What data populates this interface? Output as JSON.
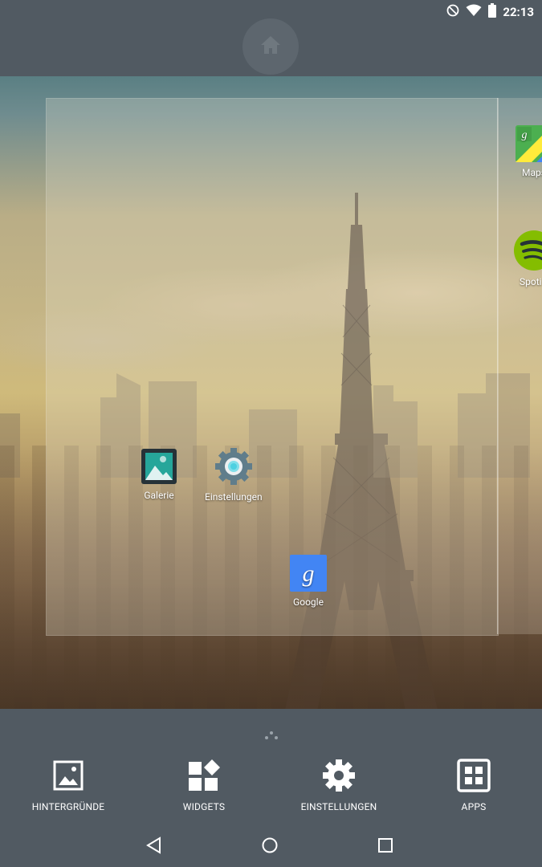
{
  "status_bar": {
    "time": "22:13",
    "icons": [
      "do-not-disturb-icon",
      "wifi-icon",
      "battery-icon"
    ]
  },
  "home_indicator": {
    "icon": "home-icon"
  },
  "workspace": {
    "apps": [
      {
        "label": "Galerie",
        "icon": "gallery-icon"
      },
      {
        "label": "Einstellungen",
        "icon": "settings-gear-icon"
      },
      {
        "label": "Google",
        "icon": "google-g-icon"
      }
    ],
    "next_page_apps": [
      {
        "label": "Maps",
        "icon": "maps-icon"
      },
      {
        "label": "Spoti",
        "icon": "spotify-icon"
      }
    ]
  },
  "options_bar": {
    "items": [
      {
        "label": "HINTERGRÜNDE",
        "icon": "wallpaper-icon"
      },
      {
        "label": "WIDGETS",
        "icon": "widgets-icon"
      },
      {
        "label": "EINSTELLUNGEN",
        "icon": "settings-icon"
      },
      {
        "label": "APPS",
        "icon": "apps-grid-icon"
      }
    ]
  },
  "nav_bar": {
    "icons": [
      "back-icon",
      "home-circle-icon",
      "recents-icon"
    ]
  },
  "colors": {
    "scrim": "#515a62",
    "accent_google": "#4285f4",
    "spotify_green": "#84bd00"
  }
}
